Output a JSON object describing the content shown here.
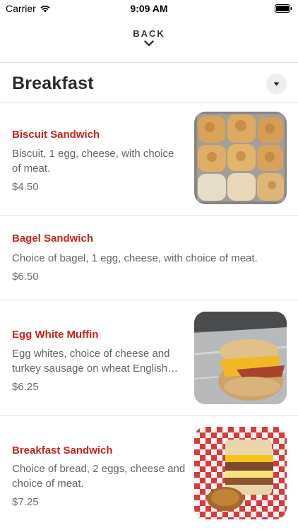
{
  "status_bar": {
    "carrier": "Carrier",
    "time": "9:09 AM"
  },
  "nav": {
    "back_label": "BACK"
  },
  "section": {
    "title": "Breakfast"
  },
  "items": [
    {
      "name": "Biscuit Sandwich",
      "description": "Biscuit, 1 egg, cheese, with choice of meat.",
      "price": "$4.50",
      "photo": "biscuits-photo"
    },
    {
      "name": "Bagel Sandwich",
      "description": "Choice of bagel, 1 egg, cheese, with choice of meat.",
      "price": "$6.50"
    },
    {
      "name": "Egg White Muffin",
      "description": "Egg whites, choice of cheese and turkey sausage on wheat English…",
      "price": "$6.25",
      "photo": "muffin-photo"
    },
    {
      "name": "Breakfast Sandwich",
      "description": "Choice of bread, 2 eggs, cheese and choice of meat.",
      "price": "$7.25",
      "photo": "breakfast-sandwich-photo"
    }
  ],
  "colors": {
    "accent": "#c8231a",
    "title": "#2b2b2b",
    "description": "#666666",
    "divider": "#e4e4e4"
  }
}
